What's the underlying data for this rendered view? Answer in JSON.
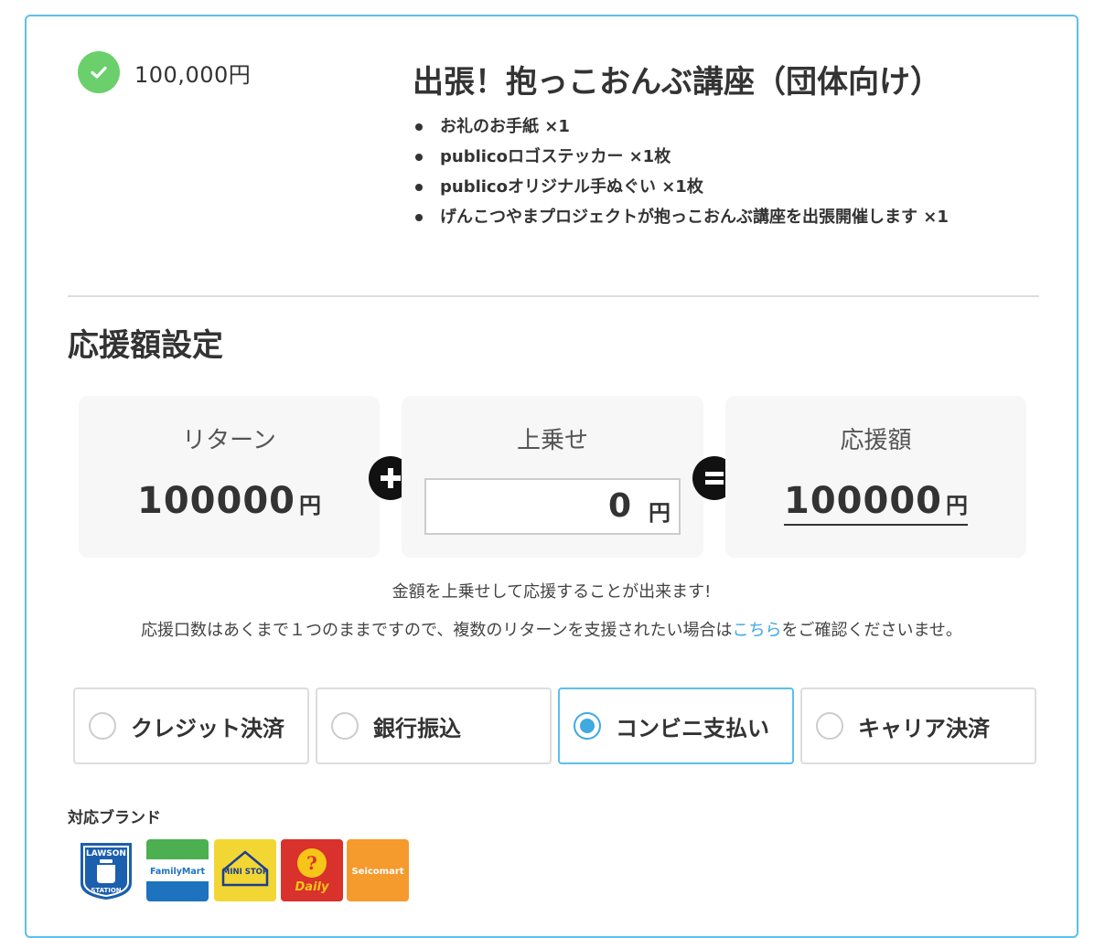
{
  "reward": {
    "price": "100,000円",
    "title": "出張！抱っこおんぶ講座（団体向け）",
    "items": [
      "お礼のお手紙 ×1",
      "publicoロゴステッカー ×1枚",
      "publicoオリジナル手ぬぐい ×1枚",
      "げんこつやまプロジェクトが抱っこおんぶ講座を出張開催します ×1"
    ]
  },
  "support": {
    "section_title": "応援額設定",
    "return_label": "リターン",
    "return_amount": "100000",
    "addon_label": "上乗せ",
    "addon_value": "0",
    "total_label": "応援額",
    "total_amount": "100000",
    "yen": "円"
  },
  "notes": {
    "line1": "金額を上乗せして応援することが出来ます!",
    "line2_before": "応援口数はあくまで１つのままですので、複数のリターンを支援されたい場合は",
    "line2_link": "こちら",
    "line2_after": "をご確認くださいませ。"
  },
  "payment": {
    "methods": [
      {
        "label": "クレジット決済",
        "selected": false
      },
      {
        "label": "銀行振込",
        "selected": false
      },
      {
        "label": "コンビニ支払い",
        "selected": true
      },
      {
        "label": "キャリア決済",
        "selected": false
      }
    ],
    "brands_title": "対応ブランド",
    "brands": [
      {
        "name": "LAWSON STATION",
        "text_top": "LAWSON",
        "text_bottom": "STATION"
      },
      {
        "name": "FamilyMart",
        "text": "FamilyMart"
      },
      {
        "name": "MINI STOP",
        "text": "MINI STOP"
      },
      {
        "name": "Daily YAMAZAKI",
        "text": "Daily"
      },
      {
        "name": "Seicomart",
        "text": "Seicomart"
      }
    ]
  },
  "colors": {
    "accent": "#5bc0eb",
    "check": "#6bd06b",
    "link": "#3fa9e0"
  }
}
